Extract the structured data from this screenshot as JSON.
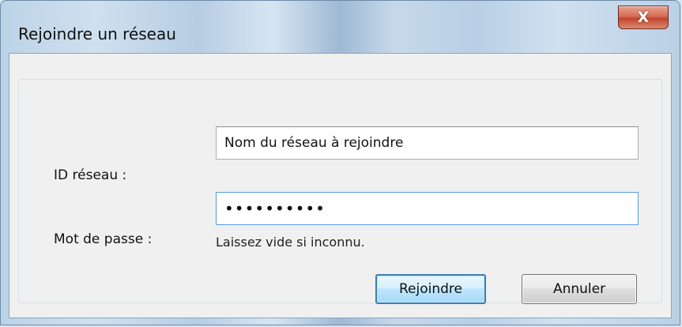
{
  "window": {
    "title": "Rejoindre un réseau",
    "close_glyph": "X"
  },
  "form": {
    "network_id": {
      "label": "ID réseau :",
      "value": "Nom du réseau à rejoindre"
    },
    "password": {
      "label": "Mot de passe :",
      "value": "••••••••••",
      "hint": "Laissez vide si inconnu."
    }
  },
  "buttons": {
    "join_label": "Rejoindre",
    "cancel_label": "Annuler"
  },
  "icons": {
    "close": "close-icon"
  },
  "colors": {
    "close_button": "#c2452d",
    "default_button_border": "#3c7fb1",
    "focus_border": "#569de5"
  }
}
